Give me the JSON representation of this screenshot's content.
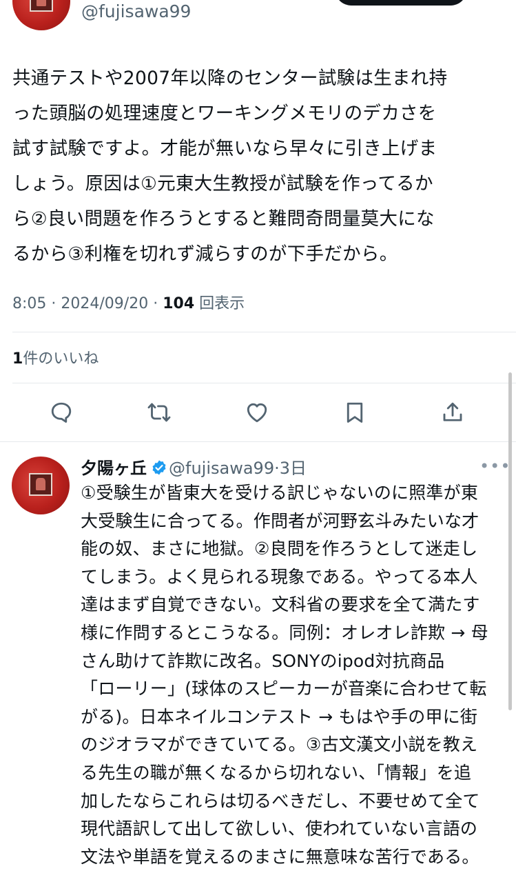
{
  "tweet": {
    "handle": "@fujisawa99",
    "text": "共通テストや2007年以降のセンター試験は生まれ持\nった頭脳の処理速度とワーキングメモリのデカさを\n試す試験ですよ。才能が無いなら早々に引き上げま\nしょう。原因は①元東大生教授が試験を作ってるか\nら②良い問題を作ろうとすると難問奇問量莫大にな\nるから③利権を切れず減らすのが下手だから。",
    "time": "8:05",
    "date": "2024/09/20",
    "views_count": "104",
    "views_label": "回表示",
    "likes_count": "1",
    "likes_label": "件のいいね"
  },
  "actions": {
    "reply_icon": "reply-icon",
    "retweet_icon": "retweet-icon",
    "like_icon": "like-icon",
    "bookmark_icon": "bookmark-icon",
    "share_icon": "share-icon"
  },
  "reply": {
    "name": "夕陽ヶ丘",
    "handle": "@fujisawa99",
    "separator": "·",
    "time": "3日",
    "more": "•••",
    "text": "①受験生が皆東大を受ける訳じゃないのに照準が東\n大受験生に合ってる。作問者が河野玄斗みたいな才\n能の奴、まさに地獄。②良問を作ろうとして迷走し\nてしまう。よく見られる現象である。やってる本人\n達はまず自覚できない。文科省の要求を全て満たす\n様に作問するとこうなる。同例：オレオレ詐欺 → 母\nさん助けて詐欺に改名。SONYのipod対抗商品\n「ローリー」(球体のスピーカーが音楽に合わせて転\nがる)。日本ネイルコンテスト → もはや手の甲に街\nのジオラマができていてる。③古文漢文小説を教え\nる先生の職が無くなるから切れない、「情報」を追\n加したならこれらは切るべきだし、不要せめて全て\n現代語訳して出して欲しい、使われていない言語の\n文法や単語を覚えるのまさに無意味な苦行である。"
  },
  "colors": {
    "text": "#0f1419",
    "secondary": "#536471",
    "verified": "#1d9bf0",
    "divider": "#e6e9ec"
  }
}
